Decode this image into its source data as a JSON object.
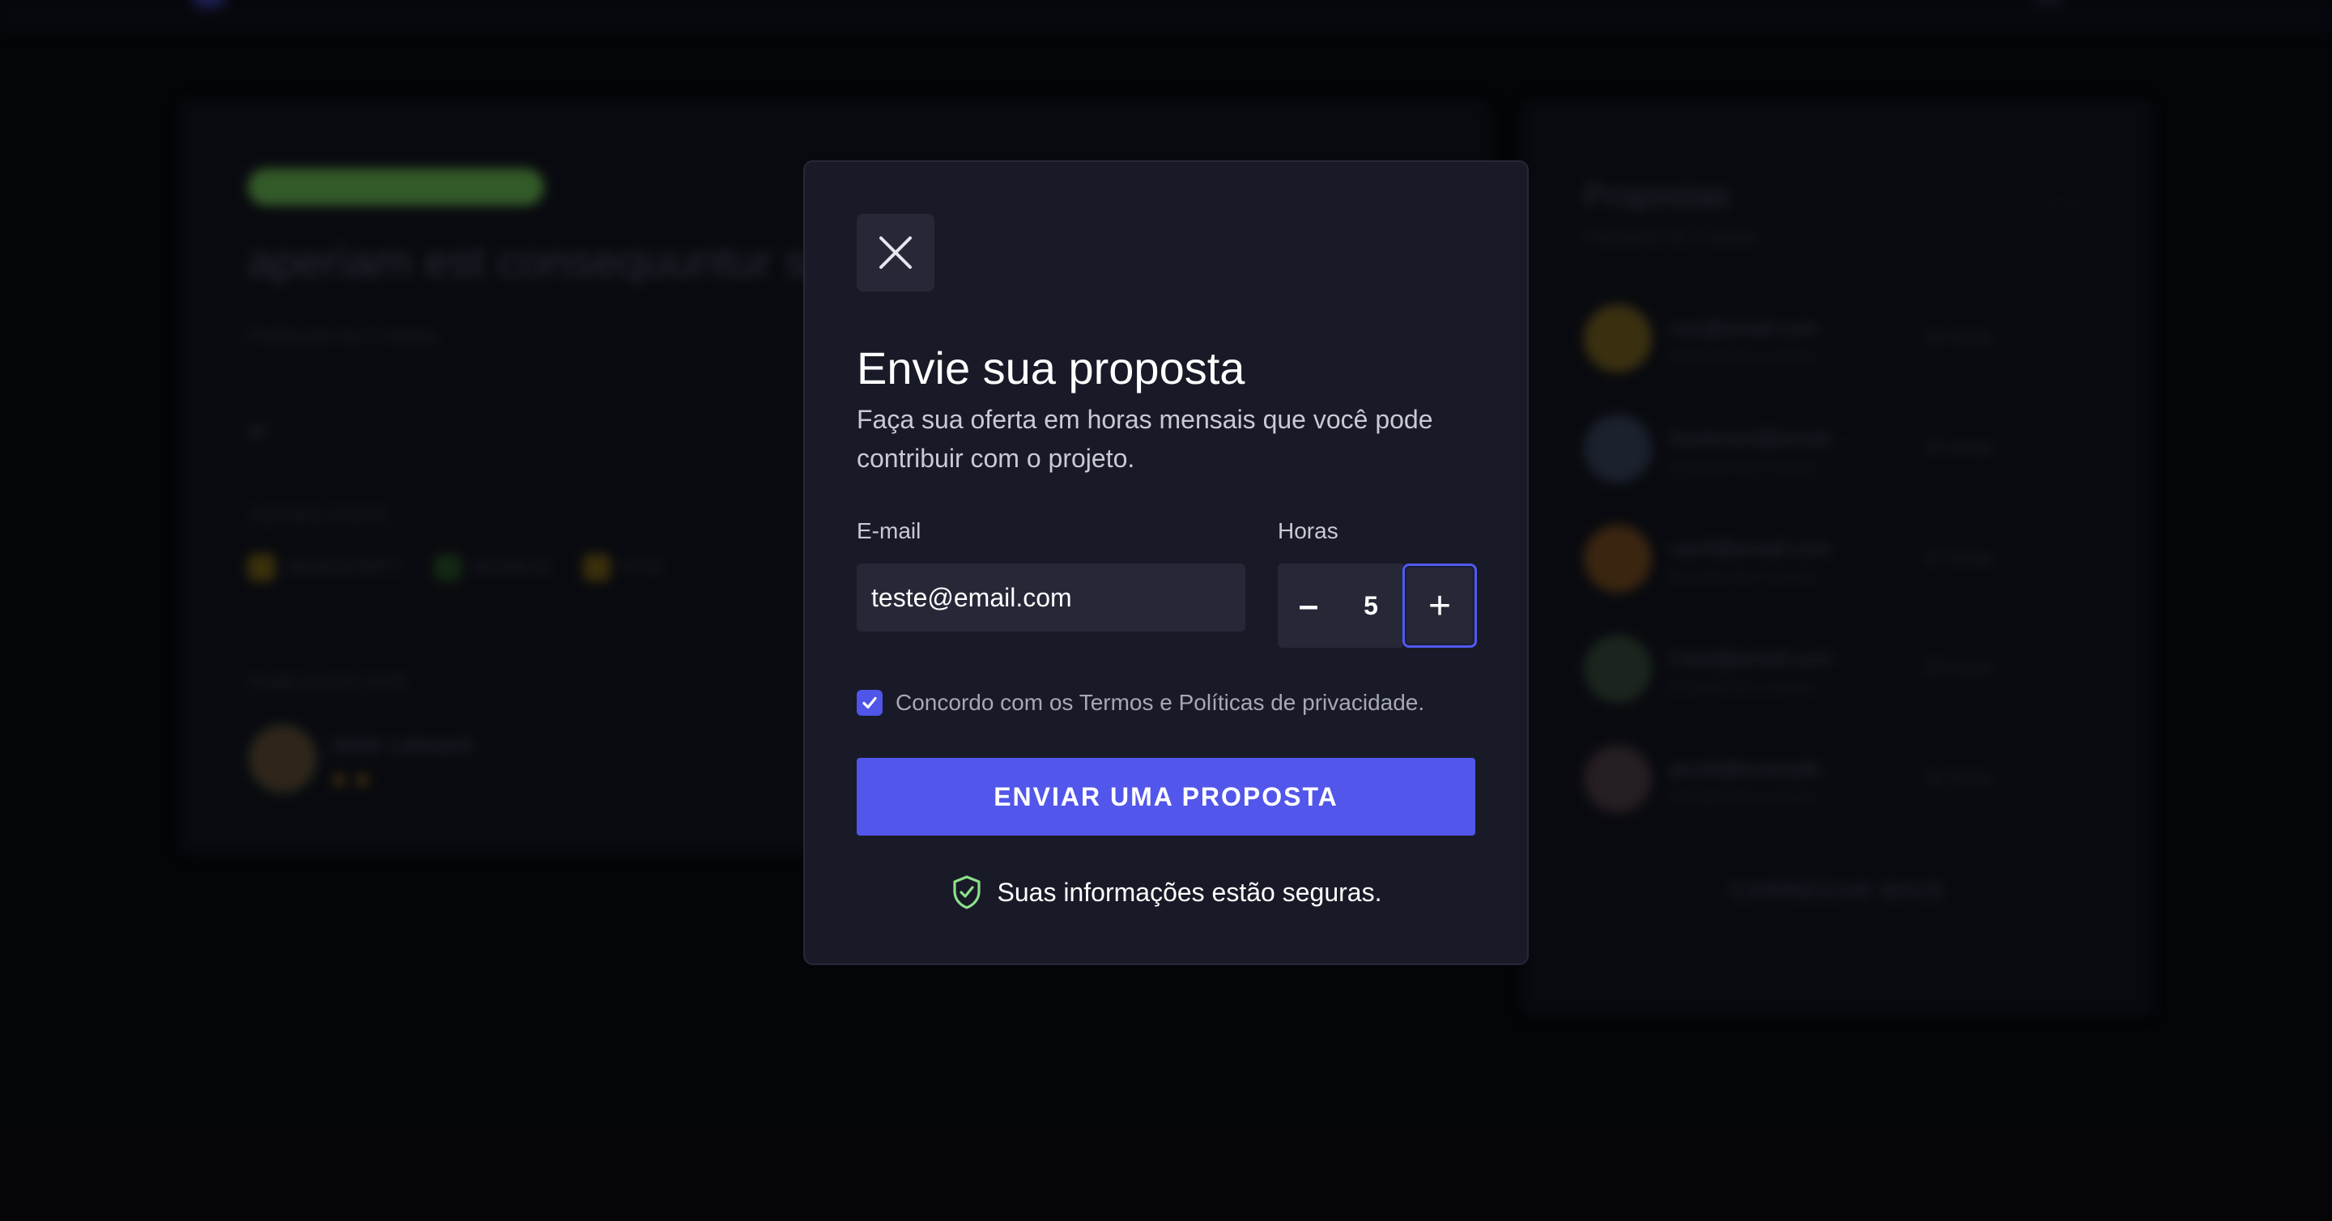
{
  "background": {
    "job": {
      "tag": "",
      "title": "aperiam est consequuntur se",
      "published": "Publicado há 3 meses",
      "description": "et",
      "tech_label": "TECNOLOGIAS",
      "techs": [
        {
          "name": "JAVASCRIPT",
          "color": "#5a4a12"
        },
        {
          "name": "NODEJS",
          "color": "#1f3f1f"
        },
        {
          "name": "VITE",
          "color": "#5a4812"
        }
      ],
      "author_label": "PUBLICADO POR",
      "author_name": "Jettie Lebsack",
      "author_stars": "★★"
    },
    "proposals": {
      "title": "Propostas",
      "subtitle": "Publicado há 3 meses",
      "items": [
        {
          "email": "xxx@email.com",
          "date": "Enviado há 3 meses",
          "hours": "10 horas",
          "color": "#5a4a1a"
        },
        {
          "email": "frankmerl@email…",
          "date": "Enviado há 3 meses",
          "hours": "20 horas",
          "color": "#2a3346"
        },
        {
          "email": "xaml@email.com",
          "date": "Enviado há 3 meses",
          "hours": "47 horas",
          "color": "#5a3a1a"
        },
        {
          "email": "f.test@email.com",
          "date": "Enviado há 3 meses",
          "hours": "28 horas",
          "color": "#2a3a2e"
        },
        {
          "email": "jacob@example…",
          "date": "Enviado há 3 meses",
          "hours": "32 horas",
          "color": "#3a2e36"
        }
      ],
      "load_more": "CARREGAR MAIS"
    }
  },
  "modal": {
    "close_icon": "close-icon",
    "title": "Envie sua proposta",
    "subtitle": "Faça sua oferta em horas mensais que você pode contribuir com o projeto.",
    "email_label": "E-mail",
    "email_value": "teste@email.com",
    "hours_label": "Horas",
    "hours_value": "5",
    "minus_label": "–",
    "plus_label": "+",
    "terms_checked": true,
    "terms_text": "Concordo com os Termos e Políticas de privacidade.",
    "submit_label": "ENVIAR UMA PROPOSTA",
    "secure_text": "Suas informações estão seguras.",
    "secure_icon": "shield-check-icon"
  },
  "colors": {
    "accent": "#5256ea",
    "modal_bg": "#191a27",
    "input_bg": "#262838",
    "shield": "#8de08b"
  }
}
